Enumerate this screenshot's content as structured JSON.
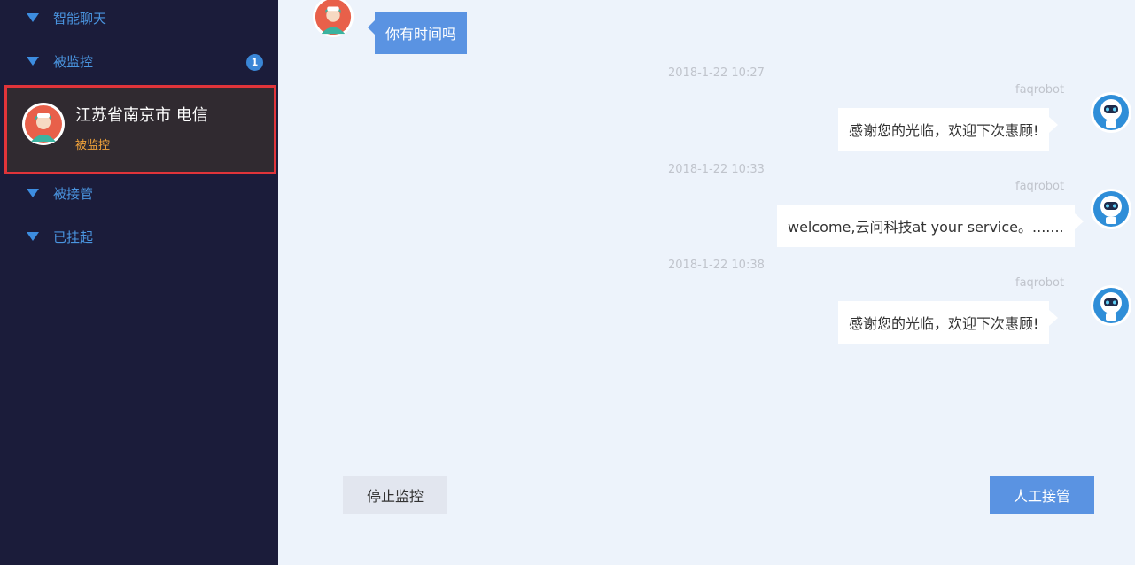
{
  "sidebar": {
    "groups": [
      {
        "label": "智能聊天"
      },
      {
        "label": "被监控",
        "badge": "1"
      },
      {
        "label": "被接管"
      },
      {
        "label": "已挂起"
      }
    ],
    "active_session": {
      "title": "江苏省南京市 电信",
      "status": "被监控"
    }
  },
  "chat": {
    "messages": [
      {
        "direction": "in",
        "text": "你有时间吗"
      },
      {
        "timestamp": "2018-1-22 10:27",
        "sender": "faqrobot",
        "direction": "out",
        "text": "感谢您的光临，欢迎下次惠顾!"
      },
      {
        "timestamp": "2018-1-22 10:33",
        "sender": "faqrobot",
        "direction": "out",
        "text": "welcome,云问科技at your service。......."
      },
      {
        "timestamp": "2018-1-22 10:38",
        "sender": "faqrobot",
        "direction": "out",
        "text": "感谢您的光临，欢迎下次惠顾!"
      }
    ]
  },
  "actions": {
    "stop_label": "停止监控",
    "takeover_label": "人工接管"
  },
  "colors": {
    "sidebar_bg": "#1b1c3a",
    "accent": "#5a93e2",
    "highlight_border": "#e0343a",
    "status_orange": "#f0a23a"
  },
  "icons": {
    "user_avatar": "user-avatar-icon",
    "robot_avatar": "robot-avatar-icon"
  }
}
